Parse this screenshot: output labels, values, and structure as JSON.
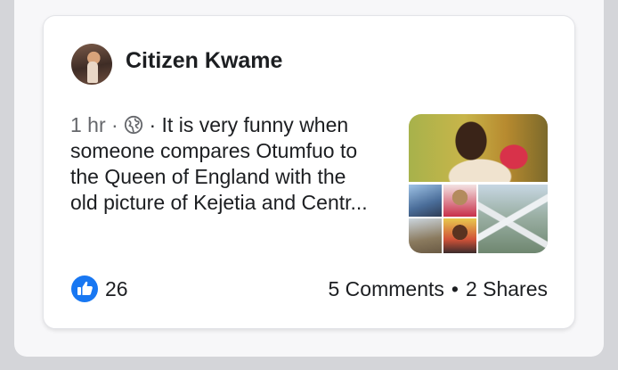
{
  "post": {
    "author": "Citizen Kwame",
    "time": "1 hr",
    "dot": "·",
    "text_lines": [
      "· It is very funny when",
      "someone compares Otumfuo to",
      "the Queen of England with the",
      "old picture of Kejetia and Centr..."
    ],
    "likes": "26",
    "comments": "5 Comments",
    "separator": "•",
    "shares": "2 Shares"
  },
  "icons": {
    "privacy": "globe-icon",
    "reaction": "like-icon"
  },
  "colors": {
    "like_blue": "#1877f2",
    "text_primary": "#1c1e21",
    "text_secondary": "#65676b"
  }
}
